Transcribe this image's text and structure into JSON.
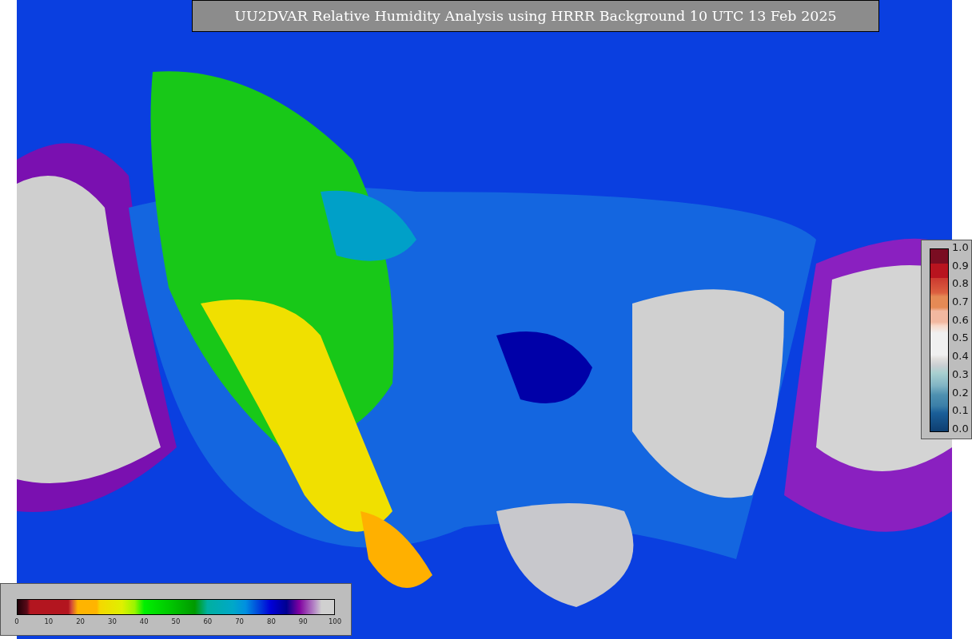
{
  "title": "UU2DVAR Relative Humidity Analysis using HRRR Background 10 UTC 13 Feb 2025",
  "humidity_colorbar": {
    "ticks": [
      "0",
      "10",
      "20",
      "30",
      "40",
      "50",
      "60",
      "70",
      "80",
      "90",
      "100"
    ]
  },
  "ratio_colorbar": {
    "ticks": [
      "1.0",
      "0.9",
      "0.8",
      "0.7",
      "0.6",
      "0.5",
      "0.4",
      "0.3",
      "0.2",
      "0.1",
      "0.0"
    ]
  }
}
